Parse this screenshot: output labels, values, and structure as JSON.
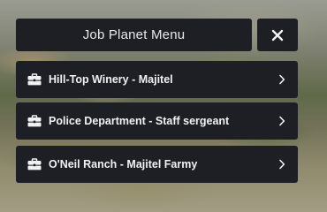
{
  "menu": {
    "title": "Job Planet Menu",
    "close_icon": "close-icon",
    "items": [
      {
        "label": "Hill-Top Winery - Majitel",
        "icon": "briefcase-icon",
        "arrow_icon": "chevron-right-icon"
      },
      {
        "label": "Police Department - Staff sergeant",
        "icon": "briefcase-icon",
        "arrow_icon": "chevron-right-icon"
      },
      {
        "label": "O'Neil Ranch - Majitel Farmy",
        "icon": "briefcase-icon",
        "arrow_icon": "chevron-right-icon"
      }
    ]
  },
  "colors": {
    "panel": "#1e1f24",
    "text": "#f1f1f3"
  }
}
